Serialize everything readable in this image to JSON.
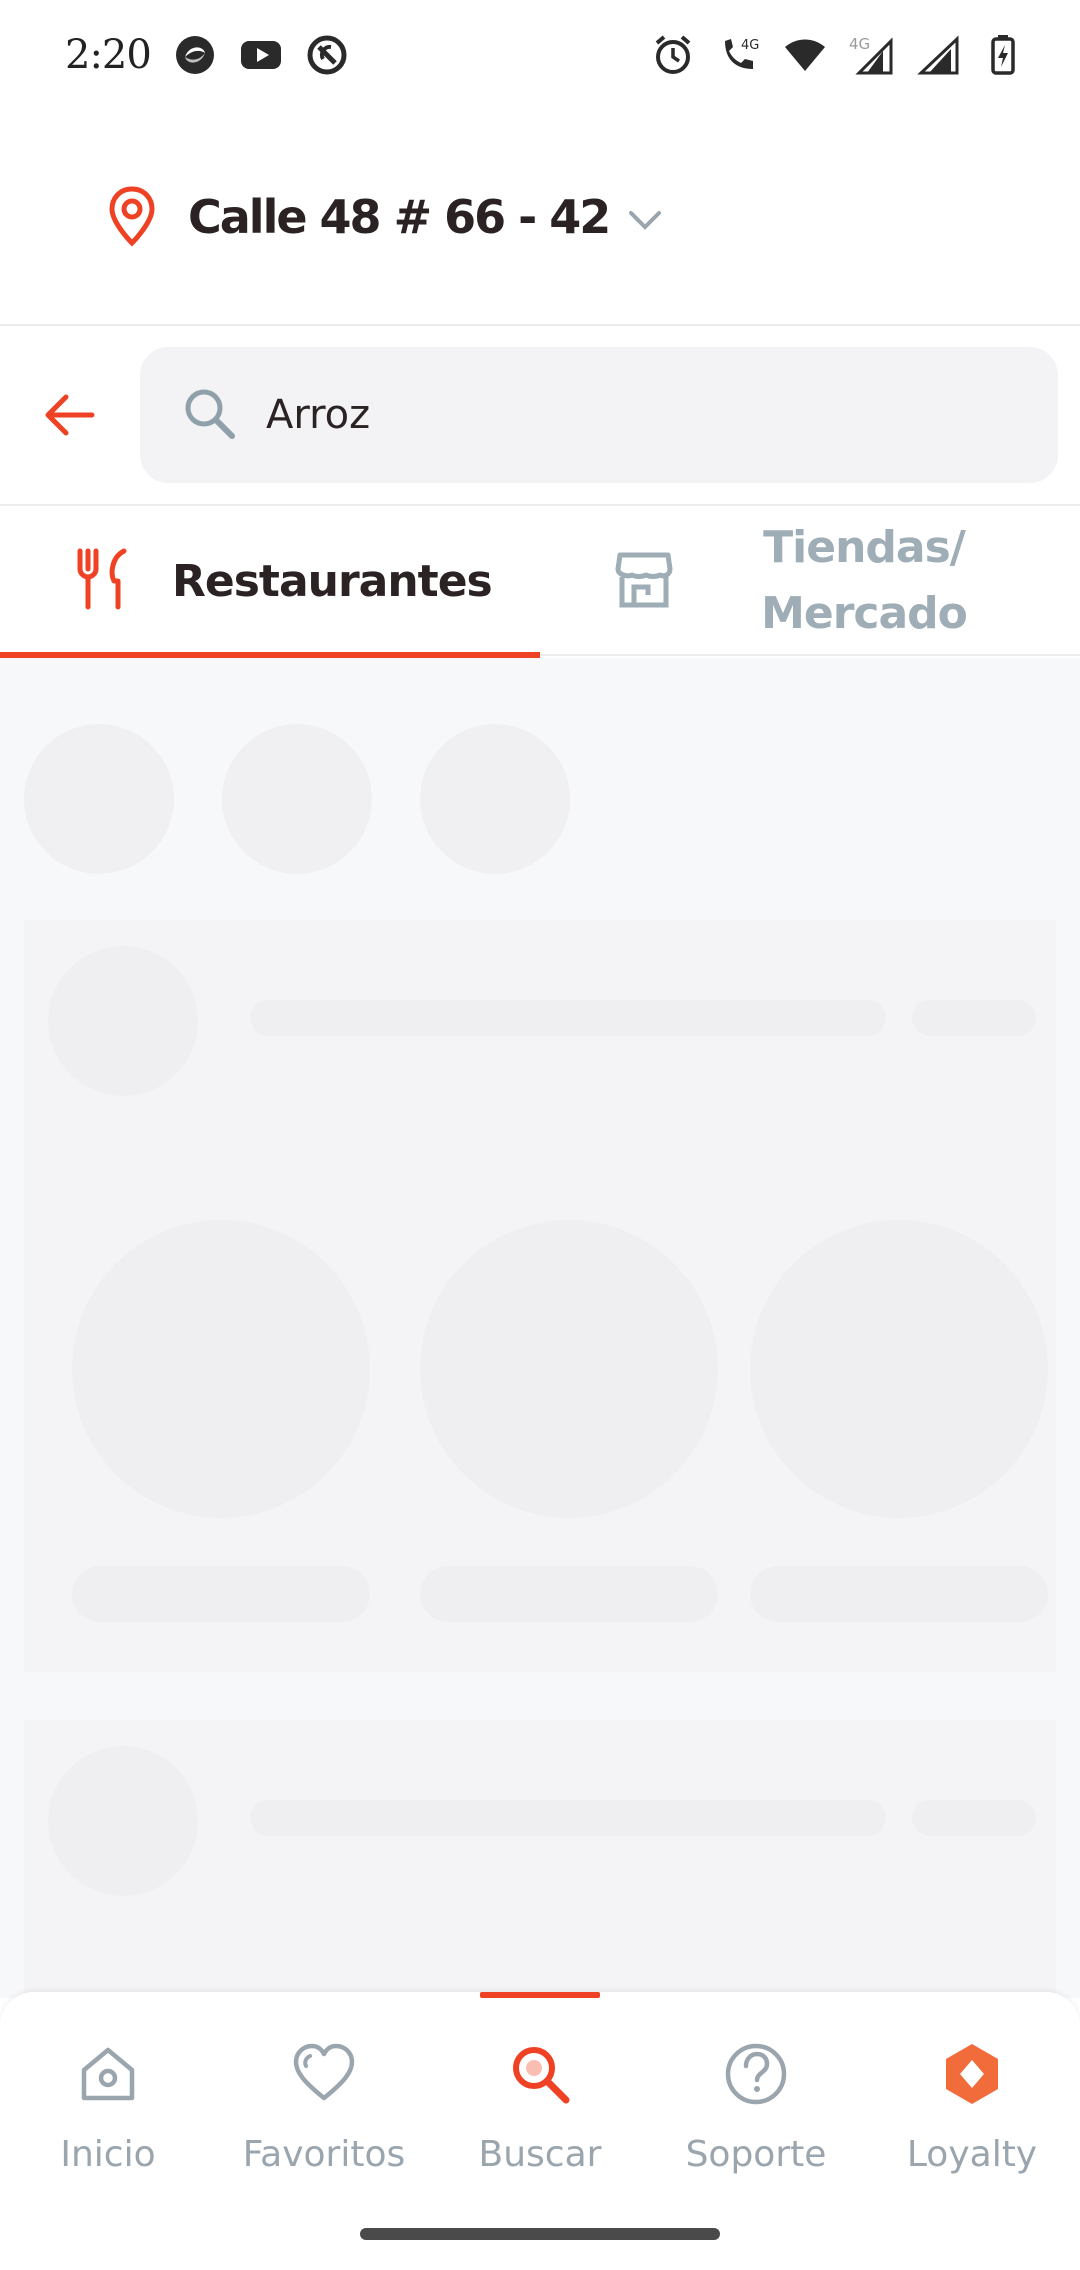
{
  "status_bar": {
    "time": "2:20",
    "network_label": "4G",
    "network_label_2": "4G"
  },
  "header": {
    "address": "Calle 48 # 66 - 42"
  },
  "search": {
    "value": "Arroz",
    "placeholder": ""
  },
  "tabs": {
    "restaurants_label": "Restaurantes",
    "stores_label": "Tiendas/ Mercado",
    "active": "restaurants"
  },
  "bottom_nav": {
    "items": [
      {
        "label": "Inicio",
        "icon": "home-icon"
      },
      {
        "label": "Favoritos",
        "icon": "heart-icon"
      },
      {
        "label": "Buscar",
        "icon": "search-icon"
      },
      {
        "label": "Soporte",
        "icon": "help-icon"
      },
      {
        "label": "Loyalty",
        "icon": "loyalty-icon"
      }
    ],
    "active_index": 2
  },
  "colors": {
    "accent": "#ef4123",
    "inactive_text": "#9aa5ad",
    "tab_inactive": "#9fadb6",
    "text_dark": "#2a2223",
    "loyalty": "#f26b3a"
  }
}
